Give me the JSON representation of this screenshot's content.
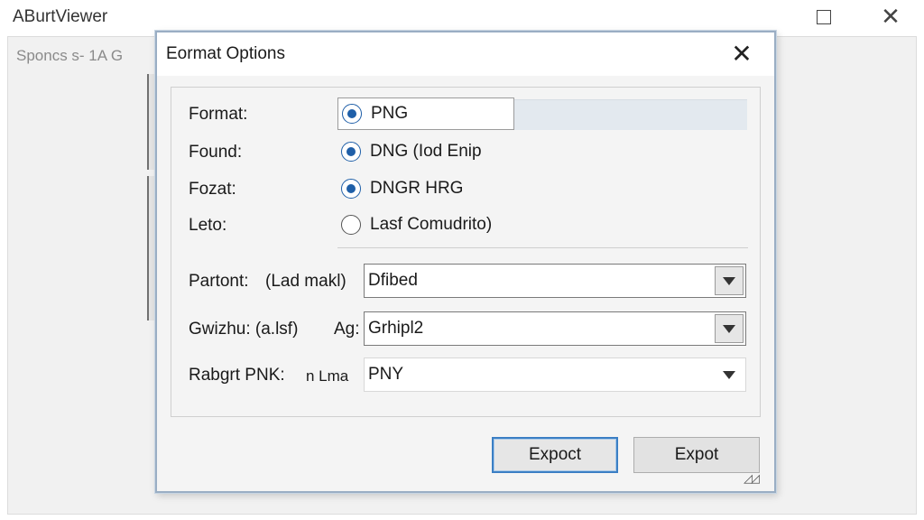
{
  "main_window": {
    "title": "ABurtViewer",
    "subtitle": "Sponcs s- 1A G",
    "maximize_glyph": "",
    "close_glyph": "✕"
  },
  "dialog": {
    "title": "Eormat Options",
    "close_glyph": "✕",
    "rows": [
      {
        "label": "Format:",
        "option": "PNG",
        "selected": true
      },
      {
        "label": "Found:",
        "option": "DNG (Iod Enip",
        "selected": true
      },
      {
        "label": "Fozat:",
        "option": "DNGR HRG",
        "selected": true
      },
      {
        "label": "Leto:",
        "option": "Lasf Comudrito)",
        "selected": false
      }
    ],
    "combos": [
      {
        "label": "Partont:",
        "label2": "(Lad makl)",
        "value": "Dfibed"
      },
      {
        "label": "Gwizhu: (a.lsf)",
        "label2": "Ag:",
        "value": "Grhipl2"
      },
      {
        "label": "Rabgrt PNK:",
        "label2": "n Lma",
        "value": "PNY"
      }
    ],
    "buttons": {
      "primary": "Expoct",
      "secondary": "Expot"
    },
    "grip_glyph": "◿◿"
  }
}
